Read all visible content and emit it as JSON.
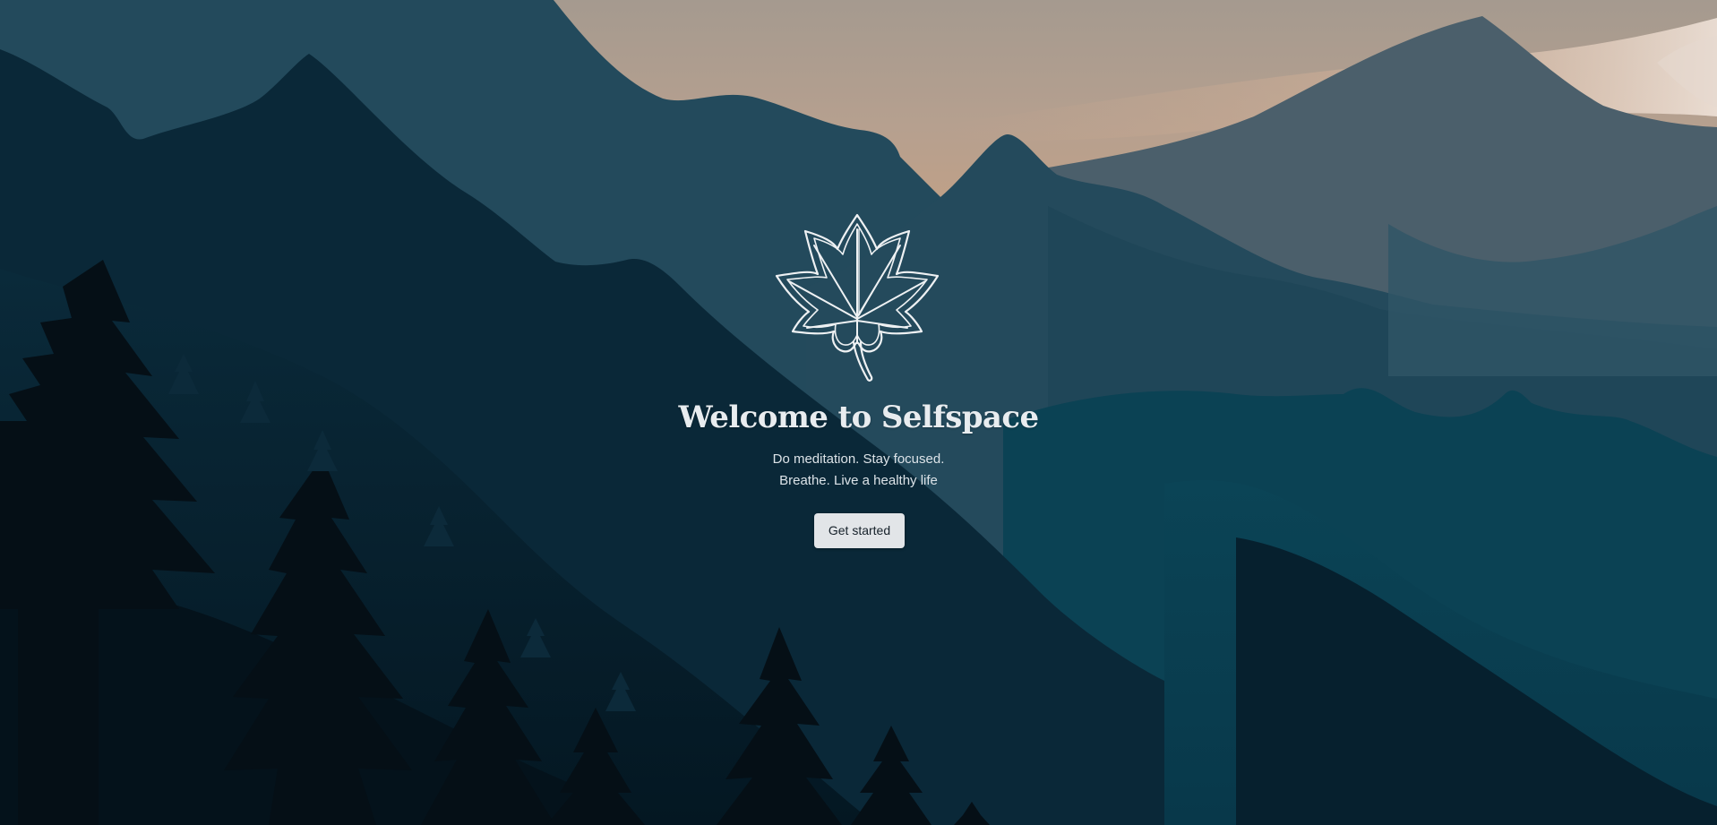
{
  "hero": {
    "title": "Welcome to Selfspace",
    "subtitle_line1": "Do meditation. Stay focused.",
    "subtitle_line2": "Breathe. Live a healthy life",
    "cta_label": "Get started",
    "logo_icon": "maple-leaf-icon"
  },
  "colors": {
    "sky_top": "#a89c8f",
    "sky_glow": "#c9a48c",
    "mountain_far": "#4d616d",
    "mountain_mid": "#214a5c",
    "mountain_deep": "#03202f",
    "forest": "#05131c",
    "text": "#e8ecef",
    "button_bg": "#e2e5e8",
    "button_text": "#16212a"
  }
}
